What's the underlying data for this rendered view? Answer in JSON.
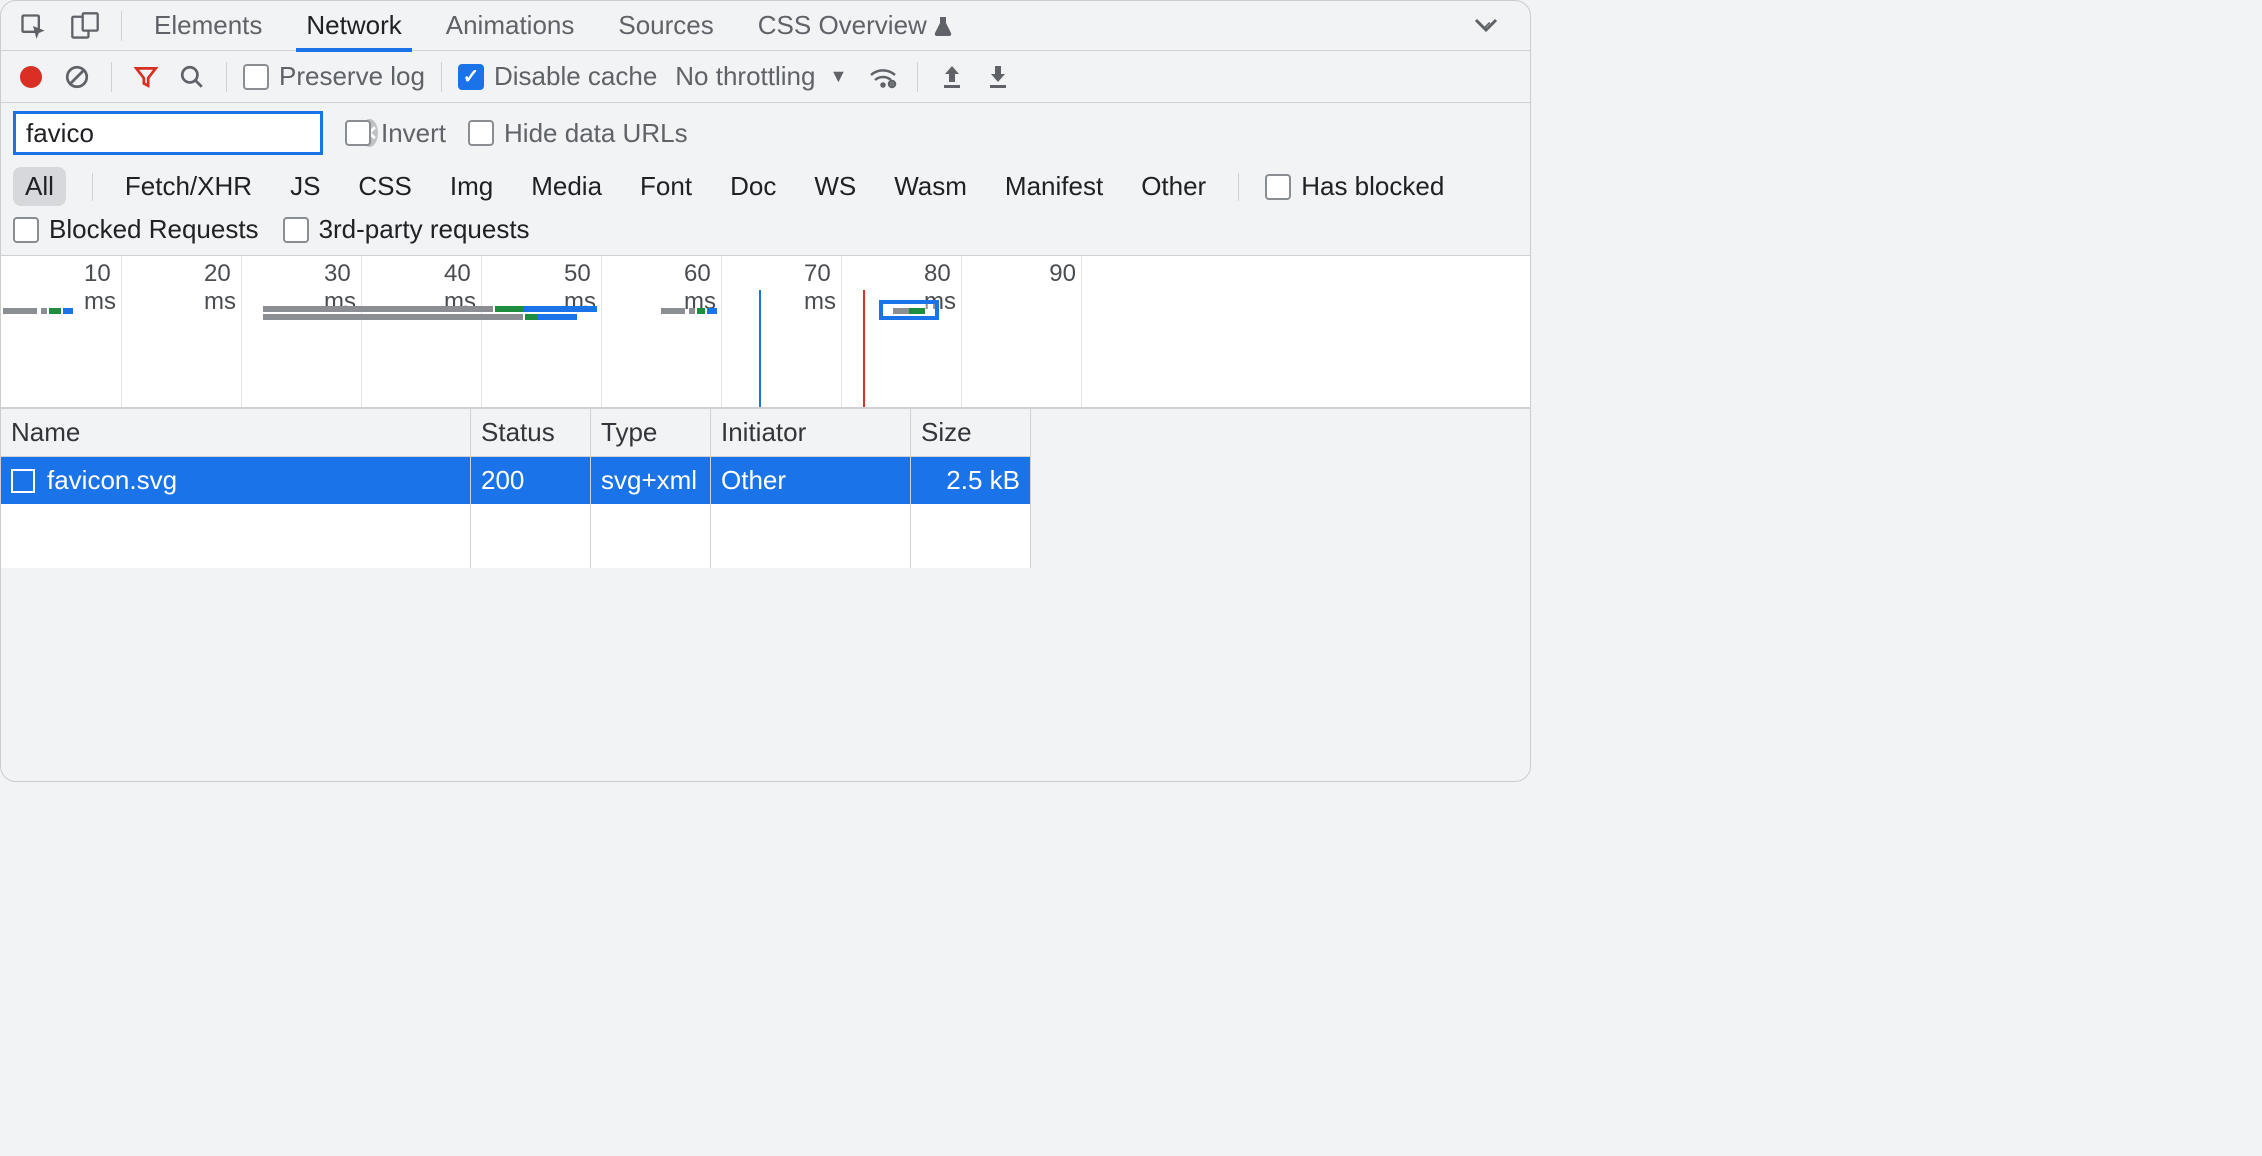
{
  "tabs": {
    "elements": "Elements",
    "network": "Network",
    "animations": "Animations",
    "sources": "Sources",
    "css_overview": "CSS Overview"
  },
  "toolbar": {
    "preserve_log": "Preserve log",
    "disable_cache": "Disable cache",
    "throttling": "No throttling"
  },
  "filter": {
    "value": "favico",
    "invert": "Invert",
    "hide_data_urls": "Hide data URLs"
  },
  "types": {
    "all": "All",
    "fetch_xhr": "Fetch/XHR",
    "js": "JS",
    "css": "CSS",
    "img": "Img",
    "media": "Media",
    "font": "Font",
    "doc": "Doc",
    "ws": "WS",
    "wasm": "Wasm",
    "manifest": "Manifest",
    "other": "Other",
    "has_blocked": "Has blocked",
    "blocked_requests": "Blocked Requests",
    "third_party": "3rd-party requests"
  },
  "timeline": {
    "ticks": [
      "10 ms",
      "20 ms",
      "30 ms",
      "40 ms",
      "50 ms",
      "60 ms",
      "70 ms",
      "80 ms",
      "90"
    ]
  },
  "table": {
    "headers": {
      "name": "Name",
      "status": "Status",
      "type": "Type",
      "initiator": "Initiator",
      "size": "Size"
    },
    "rows": [
      {
        "name": "favicon.svg",
        "status": "200",
        "type": "svg+xml",
        "initiator": "Other",
        "size": "2.5 kB"
      }
    ]
  }
}
